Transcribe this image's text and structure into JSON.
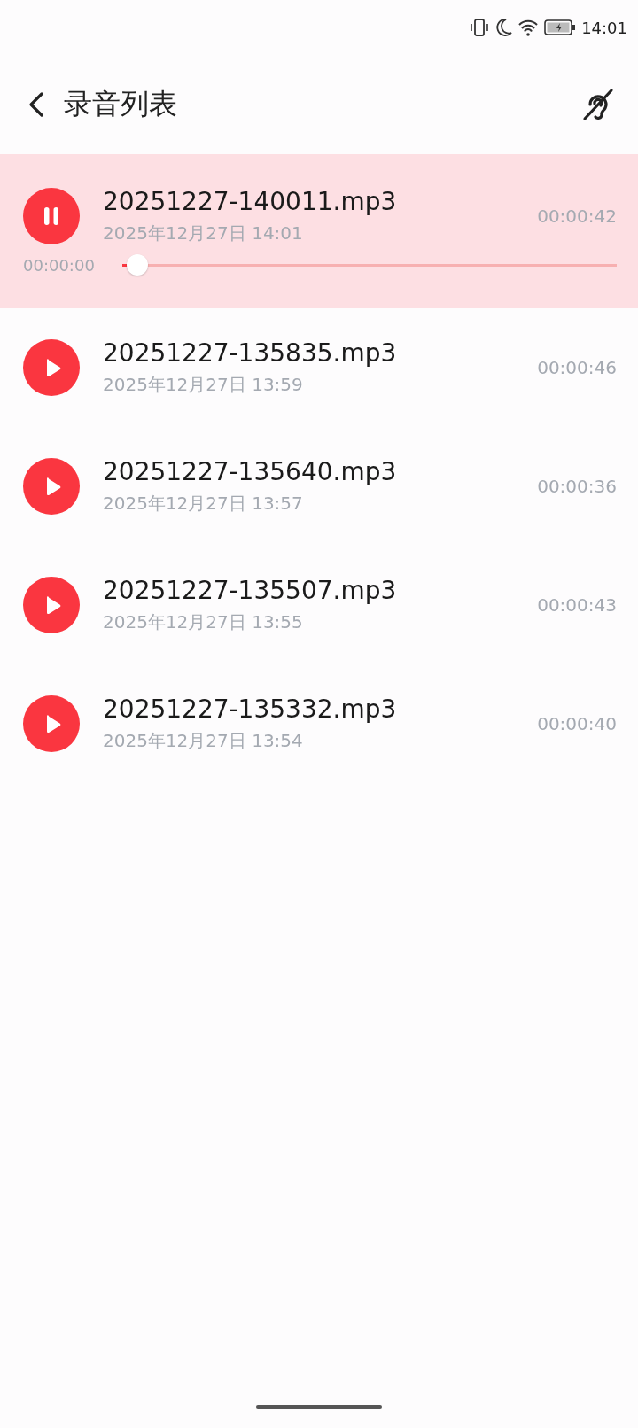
{
  "status_bar": {
    "time": "14:01"
  },
  "header": {
    "title": "录音列表"
  },
  "recordings": [
    {
      "name": "20251227-140011.mp3",
      "date": "2025年12月27日 14:01",
      "duration": "00:00:42",
      "selected": true,
      "playing": true,
      "progress": {
        "position": "00:00:00",
        "level": 0.01
      }
    },
    {
      "name": "20251227-135835.mp3",
      "date": "2025年12月27日 13:59",
      "duration": "00:00:46",
      "selected": false,
      "playing": false
    },
    {
      "name": "20251227-135640.mp3",
      "date": "2025年12月27日 13:57",
      "duration": "00:00:36",
      "selected": false,
      "playing": false
    },
    {
      "name": "20251227-135507.mp3",
      "date": "2025年12月27日 13:55",
      "duration": "00:00:43",
      "selected": false,
      "playing": false
    },
    {
      "name": "20251227-135332.mp3",
      "date": "2025年12月27日 13:54",
      "duration": "00:00:40",
      "selected": false,
      "playing": false
    }
  ]
}
